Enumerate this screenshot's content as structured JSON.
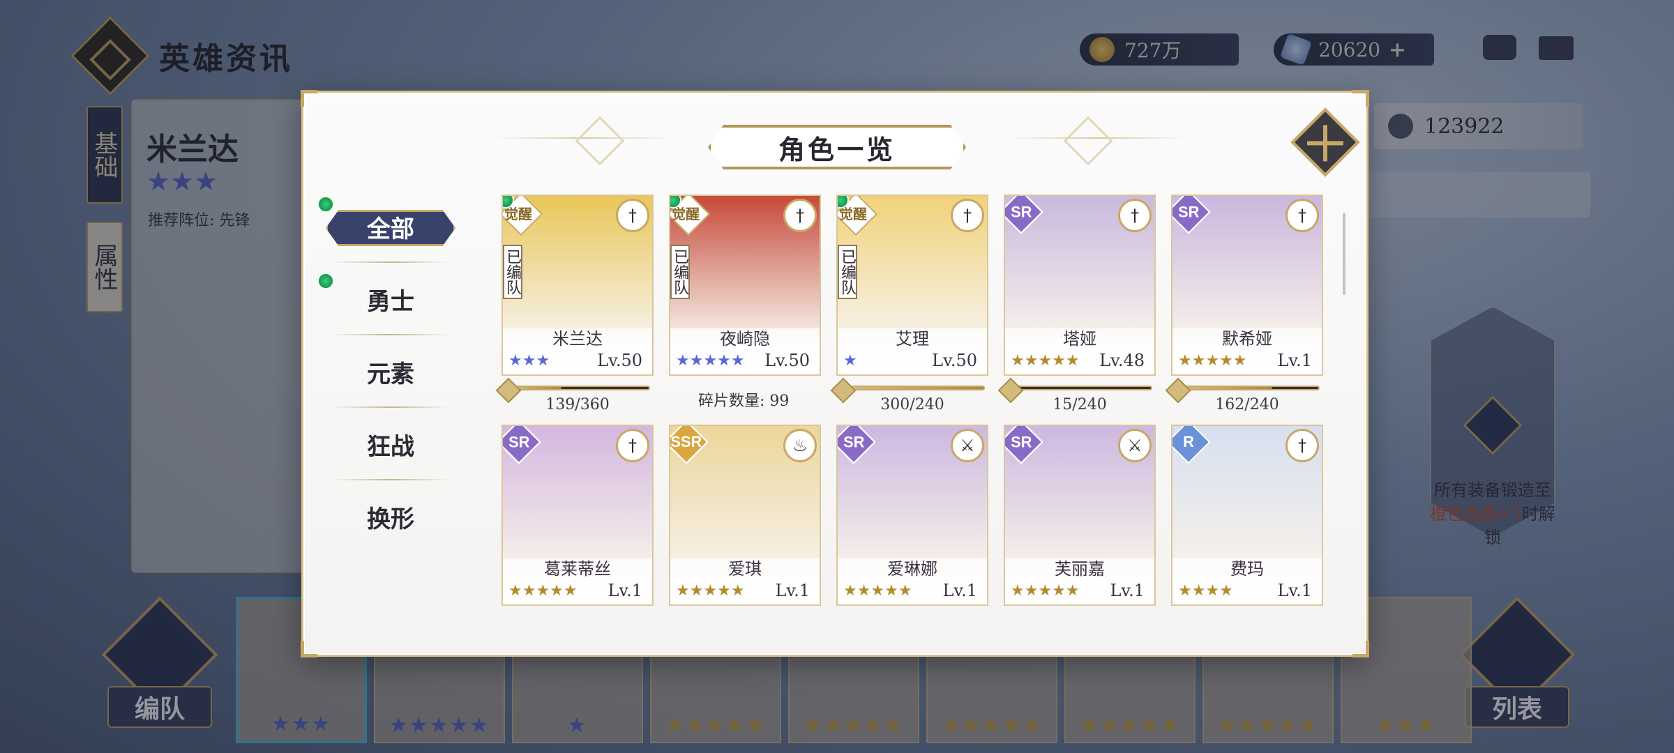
{
  "header": {
    "title": "英雄资讯",
    "gold": "727万",
    "gems": "20620",
    "gems_plus": "+"
  },
  "background": {
    "hero_name": "米兰达",
    "hero_stars": "★★★",
    "recommended_position": "推荐阵位: 先锋",
    "side_tabs": [
      "基础",
      "属性"
    ],
    "score": "123922",
    "lock_text_1": "所有装备锻造至",
    "lock_text_hl": "橙色品质+1",
    "lock_text_2": "时解锁",
    "team_button": "编队",
    "list_button": "列表",
    "roster_stars": [
      {
        "stars": "★★★",
        "color": "blue"
      },
      {
        "stars": "★★★★★",
        "color": "blue"
      },
      {
        "stars": "★",
        "color": "blue"
      },
      {
        "stars": "★★★★★",
        "color": "gold"
      },
      {
        "stars": "★★★★★",
        "color": "gold"
      },
      {
        "stars": "★★★★★",
        "color": "gold"
      },
      {
        "stars": "★★★★★",
        "color": "gold"
      },
      {
        "stars": "★★★★★",
        "color": "gold"
      },
      {
        "stars": "★★★",
        "color": "gold"
      }
    ]
  },
  "modal": {
    "title": "角色一览",
    "filters": [
      "全部",
      "勇士",
      "元素",
      "狂战",
      "换形"
    ],
    "shard_count_label": "碎片数量: 99",
    "cards": [
      {
        "name": "米兰达",
        "level": "Lv.50",
        "stars": "★★★",
        "star_color": "blue",
        "rarity": "",
        "awakened": "觉醒",
        "team": "已编队",
        "class_icon": "†",
        "art": "#e9c65a",
        "shard": "139/360",
        "shard_fill": 0.386
      },
      {
        "name": "夜崎隐",
        "level": "Lv.50",
        "stars": "★★★★★",
        "star_color": "blue",
        "rarity": "",
        "awakened": "觉醒",
        "team": "已编队",
        "class_icon": "†",
        "art": "#c64a3a",
        "shard": "",
        "shard_fill": null
      },
      {
        "name": "艾理",
        "level": "Lv.50",
        "stars": "★",
        "star_color": "blue",
        "rarity": "",
        "awakened": "觉醒",
        "team": "已编队",
        "class_icon": "†",
        "art": "#f1d27a",
        "shard": "300/240",
        "shard_fill": 1.0
      },
      {
        "name": "塔娅",
        "level": "Lv.48",
        "stars": "★★★★★",
        "star_color": "gold",
        "rarity": "SR",
        "awakened": "",
        "team": "",
        "class_icon": "†",
        "art": "#c9b9de",
        "shard": "15/240",
        "shard_fill": 0.0625
      },
      {
        "name": "默希娅",
        "level": "Lv.1",
        "stars": "★★★★★",
        "star_color": "gold",
        "rarity": "SR",
        "awakened": "",
        "team": "",
        "class_icon": "†",
        "art": "#cbb6de",
        "shard": "162/240",
        "shard_fill": 0.675
      },
      {
        "name": "葛莱蒂丝",
        "level": "Lv.1",
        "stars": "★★★★★",
        "star_color": "gold",
        "rarity": "SR",
        "awakened": "",
        "team": "",
        "class_icon": "†",
        "art": "#d4b7e0",
        "shard": "",
        "shard_fill": null
      },
      {
        "name": "爱琪",
        "level": "Lv.1",
        "stars": "★★★★★",
        "star_color": "gold",
        "rarity": "SSR",
        "awakened": "",
        "team": "",
        "class_icon": "♨",
        "art": "#ecd69a",
        "shard": "",
        "shard_fill": null
      },
      {
        "name": "爱琳娜",
        "level": "Lv.1",
        "stars": "★★★★★",
        "star_color": "gold",
        "rarity": "SR",
        "awakened": "",
        "team": "",
        "class_icon": "⚔",
        "art": "#cdb8e0",
        "shard": "",
        "shard_fill": null
      },
      {
        "name": "芙丽嘉",
        "level": "Lv.1",
        "stars": "★★★★★",
        "star_color": "gold",
        "rarity": "SR",
        "awakened": "",
        "team": "",
        "class_icon": "⚔",
        "art": "#cdb8e0",
        "shard": "",
        "shard_fill": null
      },
      {
        "name": "费玛",
        "level": "Lv.1",
        "stars": "★★★★",
        "star_color": "gold",
        "rarity": "R",
        "awakened": "",
        "team": "",
        "class_icon": "†",
        "art": "#d7dff0",
        "shard": "",
        "shard_fill": null
      }
    ]
  },
  "colors": {
    "accent_gold": "#c7a866",
    "navy": "#39426a",
    "star_gold": "#b48a2c",
    "star_blue": "#5a67d4"
  }
}
